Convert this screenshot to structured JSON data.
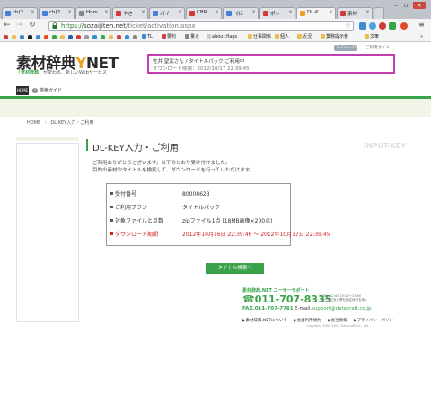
{
  "browser": {
    "tabs": [
      {
        "label": "cb(2",
        "color": "#4a7fd6"
      },
      {
        "label": "cb(2",
        "color": "#4a7fd6"
      },
      {
        "label": "Hom",
        "color": "#888888"
      },
      {
        "label": "やさ",
        "color": "#d23b3b"
      },
      {
        "label": "パイ",
        "color": "#4a7fd6"
      },
      {
        "label": "CBR",
        "color": "#d23b3b"
      },
      {
        "label": "《ほ",
        "color": "#4a7fd6"
      },
      {
        "label": "ポン",
        "color": "#d23b3b"
      },
      {
        "label": "DL-K",
        "color": "#f0a020"
      },
      {
        "label": "素材",
        "color": "#d23b3b"
      }
    ],
    "active_tab_index": 8,
    "url_scheme": "https://",
    "url_host": "sozaijiten.net",
    "url_path": "/ticket/activation.aspx",
    "bookmarks": [
      {
        "label": "TL",
        "color": "#3a8ad6"
      },
      {
        "label": "要約",
        "color": "#d23b3b"
      },
      {
        "label": "量る",
        "color": "#888888"
      },
      {
        "label": "about:flags",
        "color": "#cccccc"
      },
      {
        "label": "仕事関係",
        "color": "#e8c050"
      },
      {
        "label": "個人",
        "color": "#e8c050"
      },
      {
        "label": "近況",
        "color": "#e8c050"
      },
      {
        "label": "業務提示板",
        "color": "#e8c050"
      },
      {
        "label": "文筆",
        "color": "#e8c050"
      }
    ]
  },
  "site": {
    "logo_text": "素材辞典",
    "logo_net": "NET",
    "tagline_quote": "「素材辞典」",
    "tagline_rest": "が変わる、新しいWebサービス",
    "mypage_label": "マイページ",
    "user_guide_label": "ご利用ガイド",
    "user_line1": "佐井 望武さん / タイトルパック ご利用中",
    "user_line2": "ダウンロード期限：2012/10/17 22:39:45",
    "home_label": "HOME",
    "search_guide_label": "検索ガイド",
    "breadcrumb_home": "HOME",
    "breadcrumb_current": "DL-KEY入力・ご利用"
  },
  "main": {
    "title": "DL-KEY入力・ご利用",
    "title_en": "INPUT-KEY",
    "intro_line1": "ご利用ありがとうございます。以下のとおり受け付けました。",
    "intro_line2": "目的の素材やタイトルを検索して、ダウンロードを行っていただけます。",
    "rows": [
      {
        "key": "受付番号",
        "value": "80008623"
      },
      {
        "key": "ご利用プラン",
        "value": "タイトルパック"
      },
      {
        "key": "対象ファイルと点数",
        "value": "zipファイル1点 (18MB画像×200点)"
      },
      {
        "key": "ダウンロード期間",
        "value": "2012年10月16日 22:39:46 ～ 2012年10月17日 22:39:45"
      }
    ],
    "button_label": "タイトル検索へ"
  },
  "footer": {
    "support_title": "素材辞典.NET ユーザーサポート",
    "tel": "☎011-707-8335",
    "hours_line1": "9:30～12:00  13:00～17:00",
    "hours_line2": "土日 祝日及び弊社指定休日を除く",
    "fax": "FAX.011-707-7781",
    "email_label": "E-mail.",
    "email": "support@datacraft.co.jp",
    "nav": [
      "素材辞典.NETについて",
      "会員利用規約",
      "会社情報",
      "プライバシーポリシー"
    ],
    "copyright": "Copyright 2009-2012 Datacraft Co., Ltd."
  }
}
